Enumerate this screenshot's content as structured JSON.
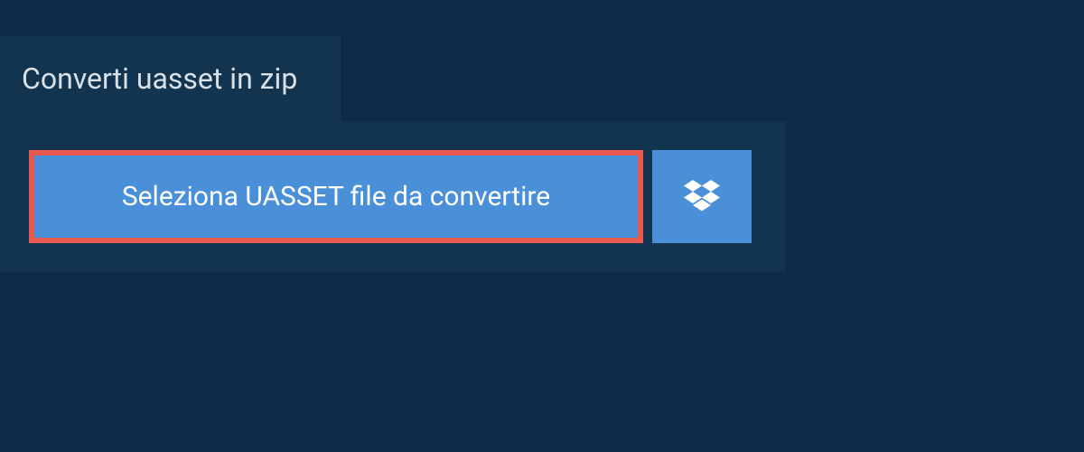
{
  "tab": {
    "title": "Converti uasset in zip"
  },
  "upload": {
    "select_file_label": "Seleziona UASSET file da convertire"
  },
  "colors": {
    "page_bg": "#0d2a47",
    "panel_bg": "#13344e",
    "button_bg": "#4a90d9",
    "highlight_border": "#e85a4f",
    "text_light": "#d8e0e8",
    "text_white": "#ffffff"
  }
}
